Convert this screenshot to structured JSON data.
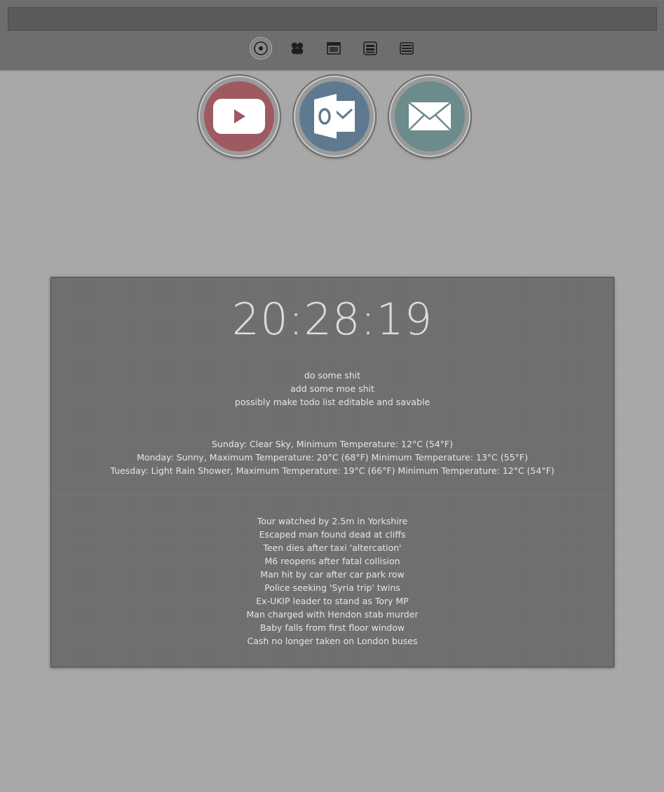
{
  "shortcuts": [
    {
      "name": "youtube",
      "icon": "youtube-icon",
      "bg_color": "#9e5a60"
    },
    {
      "name": "outlook",
      "icon": "outlook-icon",
      "bg_color": "#5f7a90"
    },
    {
      "name": "mail",
      "icon": "mail-icon",
      "bg_color": "#6b8b8d"
    }
  ],
  "tab_icons": [
    "target-icon",
    "clover-icon",
    "window-icon",
    "dotnet-icon",
    "stack-icon"
  ],
  "clock": {
    "time": "20:28:19"
  },
  "todo": {
    "items": [
      "do some shit",
      "add some moe shit",
      "possibly make todo list editable and savable"
    ]
  },
  "weather": {
    "forecasts": [
      "Sunday: Clear Sky, Minimum Temperature: 12°C (54°F)",
      "Monday: Sunny, Maximum Temperature: 20°C (68°F) Minimum Temperature: 13°C (55°F)",
      "Tuesday: Light Rain Shower, Maximum Temperature: 19°C (66°F) Minimum Temperature: 12°C (54°F)"
    ]
  },
  "news": {
    "headlines": [
      "Tour watched by 2.5m in Yorkshire",
      "Escaped man found dead at cliffs",
      "Teen dies after taxi 'altercation'",
      "M6 reopens after fatal collision",
      "Man hit by car after car park row",
      "Police seeking 'Syria trip' twins",
      "Ex-UKIP leader to stand as Tory MP",
      "Man charged with Hendon stab murder",
      "Baby falls from first floor window",
      "Cash no longer taken on London buses"
    ]
  }
}
